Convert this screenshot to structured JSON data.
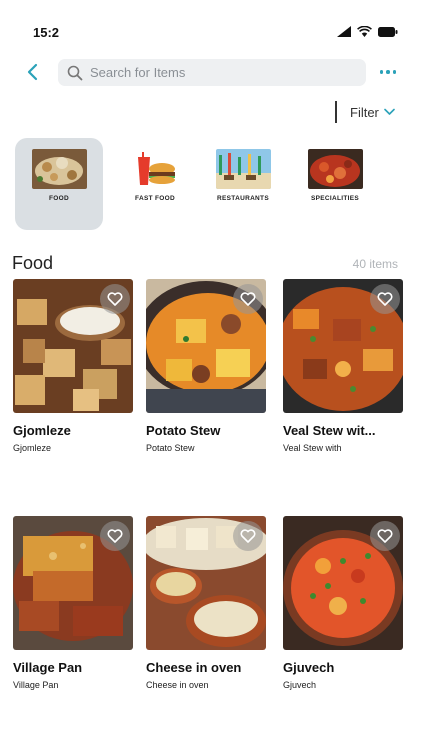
{
  "status_bar": {
    "time": "15:2"
  },
  "header": {
    "search_placeholder": "Search for Items"
  },
  "filter": {
    "label": "Filter"
  },
  "categories": [
    {
      "label": "FOOD",
      "active": true
    },
    {
      "label": "FAST FOOD",
      "active": false
    },
    {
      "label": "RESTAURANTS",
      "active": false
    },
    {
      "label": "SPECIALITIES",
      "active": false
    }
  ],
  "section": {
    "title": "Food",
    "count": "40 items"
  },
  "items": [
    {
      "name": "Gjomleze",
      "subtitle": "Gjomleze"
    },
    {
      "name": "Potato Stew",
      "subtitle": "Potato Stew"
    },
    {
      "name": "Veal Stew wit...",
      "subtitle": "Veal Stew  with"
    },
    {
      "name": "Village Pan",
      "subtitle": "Village Pan"
    },
    {
      "name": "Cheese in oven",
      "subtitle": "Cheese in oven"
    },
    {
      "name": "Gjuvech",
      "subtitle": "Gjuvech"
    }
  ],
  "colors": {
    "accent": "#2ba2b9",
    "category_active_bg": "#dadfe3",
    "search_bg": "#eef0f2"
  },
  "icons": [
    "signal-icon",
    "wifi-icon",
    "battery-icon",
    "back-arrow-icon",
    "search-icon",
    "more-icon",
    "chevron-down-icon",
    "heart-icon"
  ]
}
